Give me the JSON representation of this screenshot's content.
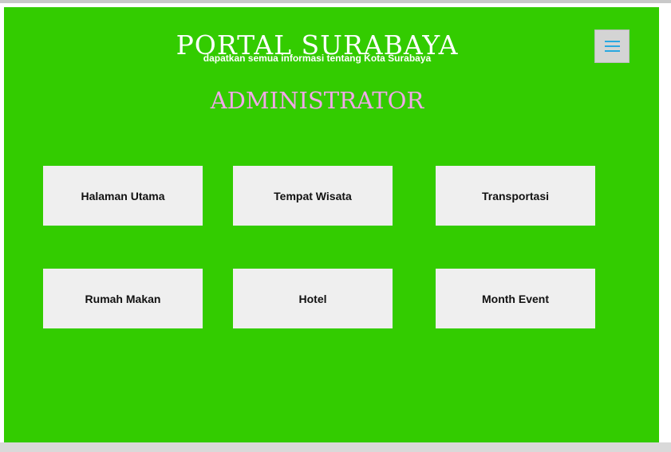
{
  "header": {
    "title": "PORTAL SURABAYA",
    "subtitle": "dapatkan semua informasi tentang Kota Surabaya",
    "menu_icon": "hamburger-menu-icon"
  },
  "main": {
    "heading": "ADMINISTRATOR",
    "menu_items": [
      {
        "label": "Halaman Utama"
      },
      {
        "label": "Tempat Wisata"
      },
      {
        "label": "Transportasi"
      },
      {
        "label": "Rumah Makan"
      },
      {
        "label": "Hotel"
      },
      {
        "label": "Month Event"
      }
    ]
  },
  "colors": {
    "background": "#33cc00",
    "heading": "#f0a8e8",
    "card": "#efefef",
    "menu_icon": "#29a8e0"
  }
}
